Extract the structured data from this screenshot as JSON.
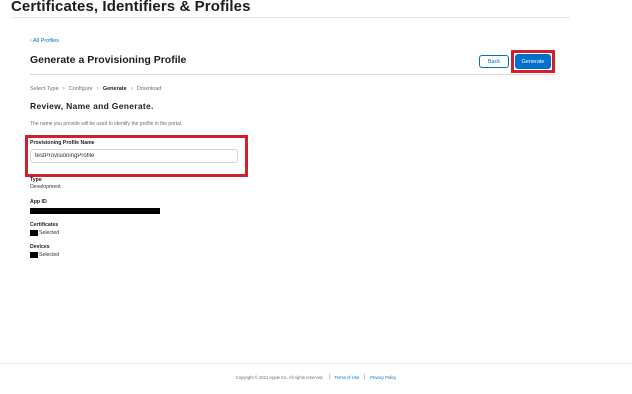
{
  "header": {
    "title": "Certificates, Identifiers & Profiles"
  },
  "nav": {
    "back_link": "‹ All Profiles"
  },
  "section": {
    "title": "Generate a Provisioning Profile"
  },
  "actions": {
    "back_label": "Back",
    "generate_label": "Generate"
  },
  "steps": [
    {
      "label": "Select Type",
      "active": false
    },
    {
      "label": "Configure",
      "active": false
    },
    {
      "label": "Generate",
      "active": true
    },
    {
      "label": "Download",
      "active": false
    }
  ],
  "step_separator": "›",
  "review": {
    "heading": "Review, Name and Generate.",
    "hint": "The name you provide will be used to identify the profile in the portal."
  },
  "profile_name": {
    "label": "Provisioning Profile Name",
    "value": "testProvisioningProfile"
  },
  "details": {
    "type_label": "Type",
    "type_value": "Development",
    "app_id_label": "App ID",
    "certificates_label": "Certificates",
    "certificates_value": "Selected",
    "devices_label": "Devices",
    "devices_value": "Selected"
  },
  "footer": {
    "copyright": "Copyright © 2021 Apple Inc. All rights reserved.",
    "terms": "Terms of Use",
    "privacy": "Privacy Policy"
  },
  "colors": {
    "accent": "#0070c9",
    "highlight": "#d0202d"
  }
}
